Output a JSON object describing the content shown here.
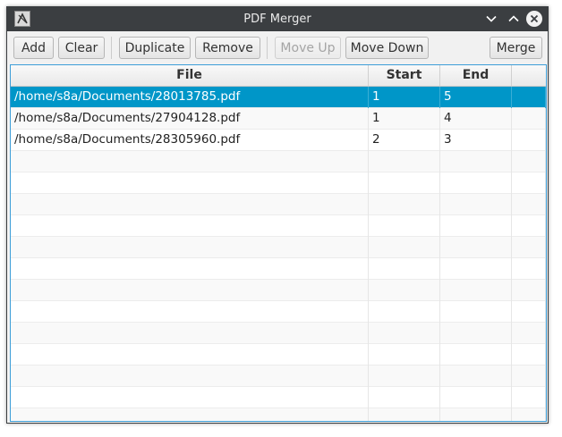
{
  "window": {
    "title": "PDF Merger",
    "app_icon": "app-logo-icon",
    "controls": [
      "minimize-icon",
      "maximize-icon",
      "close-icon"
    ]
  },
  "toolbar": {
    "add_label": "Add",
    "clear_label": "Clear",
    "duplicate_label": "Duplicate",
    "remove_label": "Remove",
    "move_up_label": "Move Up",
    "move_up_enabled": false,
    "move_down_label": "Move Down",
    "merge_label": "Merge"
  },
  "table": {
    "columns": [
      "File",
      "Start",
      "End"
    ],
    "rows": [
      {
        "file": "/home/s8a/Documents/28013785.pdf",
        "start": "1",
        "end": "5",
        "selected": true
      },
      {
        "file": "/home/s8a/Documents/27904128.pdf",
        "start": "1",
        "end": "4",
        "selected": false
      },
      {
        "file": "/home/s8a/Documents/28305960.pdf",
        "start": "2",
        "end": "3",
        "selected": false
      }
    ]
  },
  "colors": {
    "titlebar": "#3b3e41",
    "selection": "#0096c8",
    "focus_border": "#3d9ed8"
  }
}
